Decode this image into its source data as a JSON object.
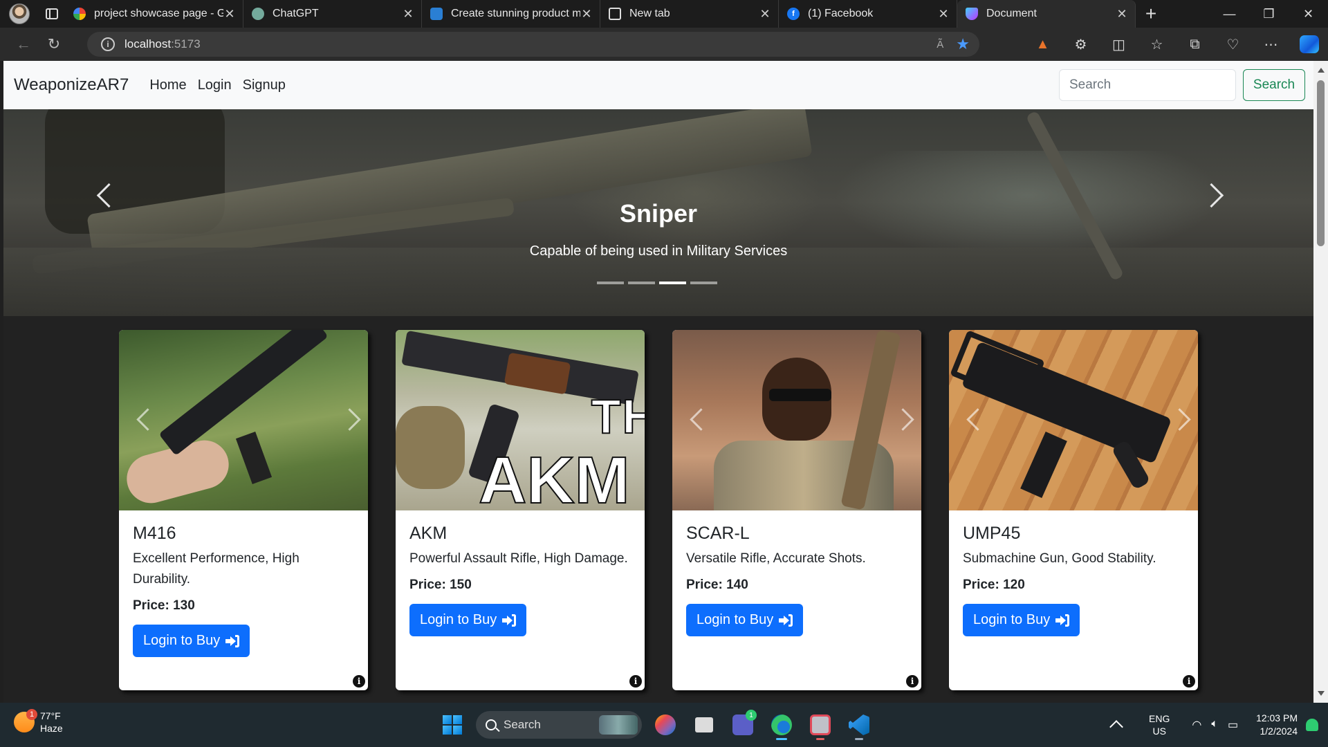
{
  "browser": {
    "tabs": [
      {
        "title": "project showcase page - G",
        "favicon": "google-icon",
        "active": false
      },
      {
        "title": "ChatGPT",
        "favicon": "chatgpt-icon",
        "active": false
      },
      {
        "title": "Create stunning product m",
        "favicon": "cloud-icon",
        "active": false
      },
      {
        "title": "New tab",
        "favicon": "newtab-icon",
        "active": false
      },
      {
        "title": "(1) Facebook",
        "favicon": "facebook-icon",
        "active": false
      },
      {
        "title": "Document",
        "favicon": "vite-icon",
        "active": true
      }
    ],
    "url_host": "localhost",
    "url_port": ":5173",
    "read_aloud": "A͂"
  },
  "site": {
    "brand": "WeaponizeAR7",
    "nav": [
      "Home",
      "Login",
      "Signup"
    ],
    "search_placeholder": "Search",
    "search_button": "Search"
  },
  "carousel": {
    "title": "Sniper",
    "caption": "Capable of being used in Military Services",
    "slide_count": 4,
    "active_index": 2
  },
  "products": [
    {
      "name": "M416",
      "desc": "Excellent Performence, High Durability.",
      "price": "Price: 130",
      "button": "Login to Buy"
    },
    {
      "name": "AKM",
      "desc": "Powerful Assault Rifle, High Damage.",
      "price": "Price: 150",
      "button": "Login to Buy",
      "image_text_top": "TH",
      "image_text_bottom": "AKM"
    },
    {
      "name": "SCAR-L",
      "desc": "Versatile Rifle, Accurate Shots.",
      "price": "Price: 140",
      "button": "Login to Buy"
    },
    {
      "name": "UMP45",
      "desc": "Submachine Gun, Good Stability.",
      "price": "Price: 120",
      "button": "Login to Buy"
    }
  ],
  "taskbar": {
    "weather_temp": "77°F",
    "weather_desc": "Haze",
    "weather_badge": "1",
    "search_label": "Search",
    "teams_badge": "1",
    "lang_top": "ENG",
    "lang_bottom": "US",
    "time": "12:03 PM",
    "date": "1/2/2024"
  },
  "colors": {
    "primary_button": "#0d6efd",
    "search_outline": "#198754",
    "navbar_bg": "#f8f9fa",
    "page_bg": "#222222"
  }
}
